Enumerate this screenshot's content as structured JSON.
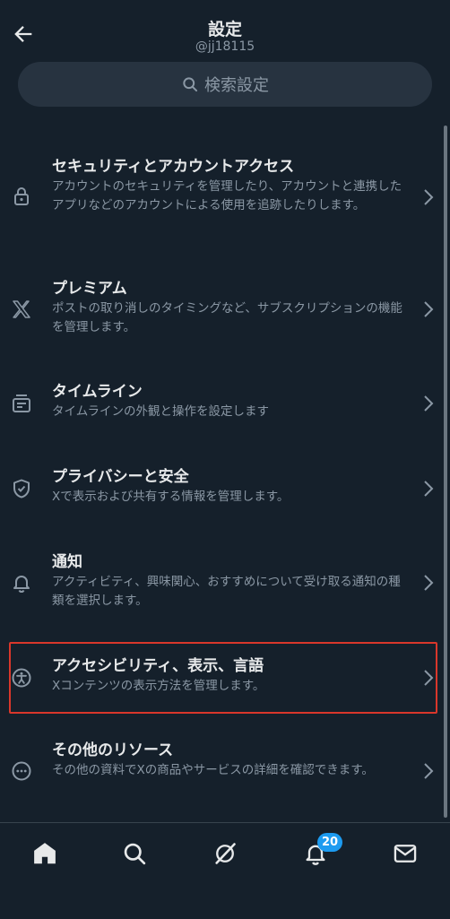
{
  "header": {
    "title": "設定",
    "handle": "@jj18115"
  },
  "search": {
    "placeholder": "検索設定"
  },
  "items": [
    {
      "label": "セキュリティとアカウントアクセス",
      "desc": "アカウントのセキュリティを管理したり、アカウントと連携したアプリなどのアカウントによる使用を追跡したりします。",
      "icon": "lock-icon"
    },
    {
      "label": "プレミアム",
      "desc": "ポストの取り消しのタイミングなど、サブスクリプションの機能を管理します。",
      "icon": "x-logo-icon"
    },
    {
      "label": "タイムライン",
      "desc": "タイムラインの外観と操作を設定します",
      "icon": "timeline-icon"
    },
    {
      "label": "プライバシーと安全",
      "desc": "Xで表示および共有する情報を管理します。",
      "icon": "shield-icon"
    },
    {
      "label": "通知",
      "desc": "アクティビティ、興味関心、おすすめについて受け取る通知の種類を選択します。",
      "icon": "bell-icon"
    },
    {
      "label": "アクセシビリティ、表示、言語",
      "desc": "Xコンテンツの表示方法を管理します。",
      "icon": "accessibility-icon"
    },
    {
      "label": "その他のリソース",
      "desc": "その他の資料でXの商品やサービスの詳細を確認できます。",
      "icon": "more-circle-icon"
    }
  ],
  "navbar": {
    "items": [
      "home-icon",
      "search-icon",
      "grok-icon",
      "notifications-icon",
      "messages-icon"
    ],
    "notification_count": "20"
  },
  "colors": {
    "background": "#15202b",
    "secondary_text": "#8b98a5",
    "accent": "#1d9bf0",
    "highlight_border": "#d9372b"
  }
}
